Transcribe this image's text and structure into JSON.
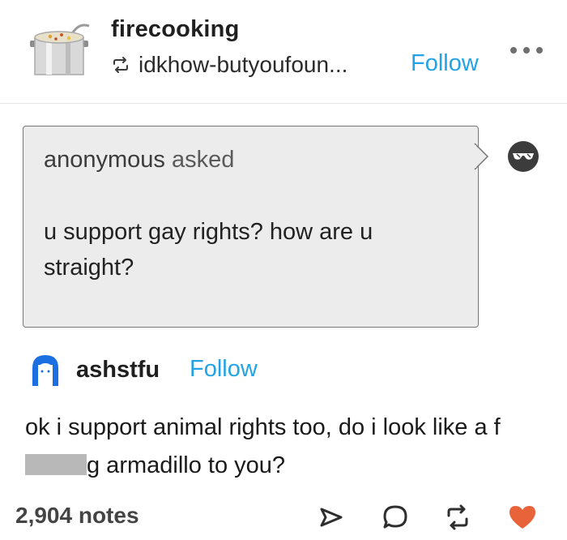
{
  "post": {
    "blog_name": "firecooking",
    "reblogged_from": "idkhow-butyoufoun...",
    "follow_label": "Follow"
  },
  "ask": {
    "asker": "anonymous",
    "asked_word": "asked",
    "question": "u support gay rights? how are u straight?"
  },
  "answer": {
    "blog_name": "ashstfu",
    "follow_label": "Follow",
    "text_before": "ok i support animal rights too, do i look like a f",
    "text_after": "g armadillo to you?"
  },
  "footer": {
    "notes": "2,904 notes"
  },
  "icons": {
    "blog_avatar": "cooking-pot-icon",
    "reblog_small": "reblog-icon",
    "more": "more-options-icon",
    "asker_avatar": "sunglasses-face-icon",
    "answer_avatar": "hooded-figure-icon",
    "share": "share-icon",
    "reply": "reply-icon",
    "reblog": "reblog-icon",
    "like": "heart-icon"
  },
  "colors": {
    "accent_link": "#22a3e6",
    "like_heart": "#e9633a",
    "ask_background": "#ececec"
  }
}
